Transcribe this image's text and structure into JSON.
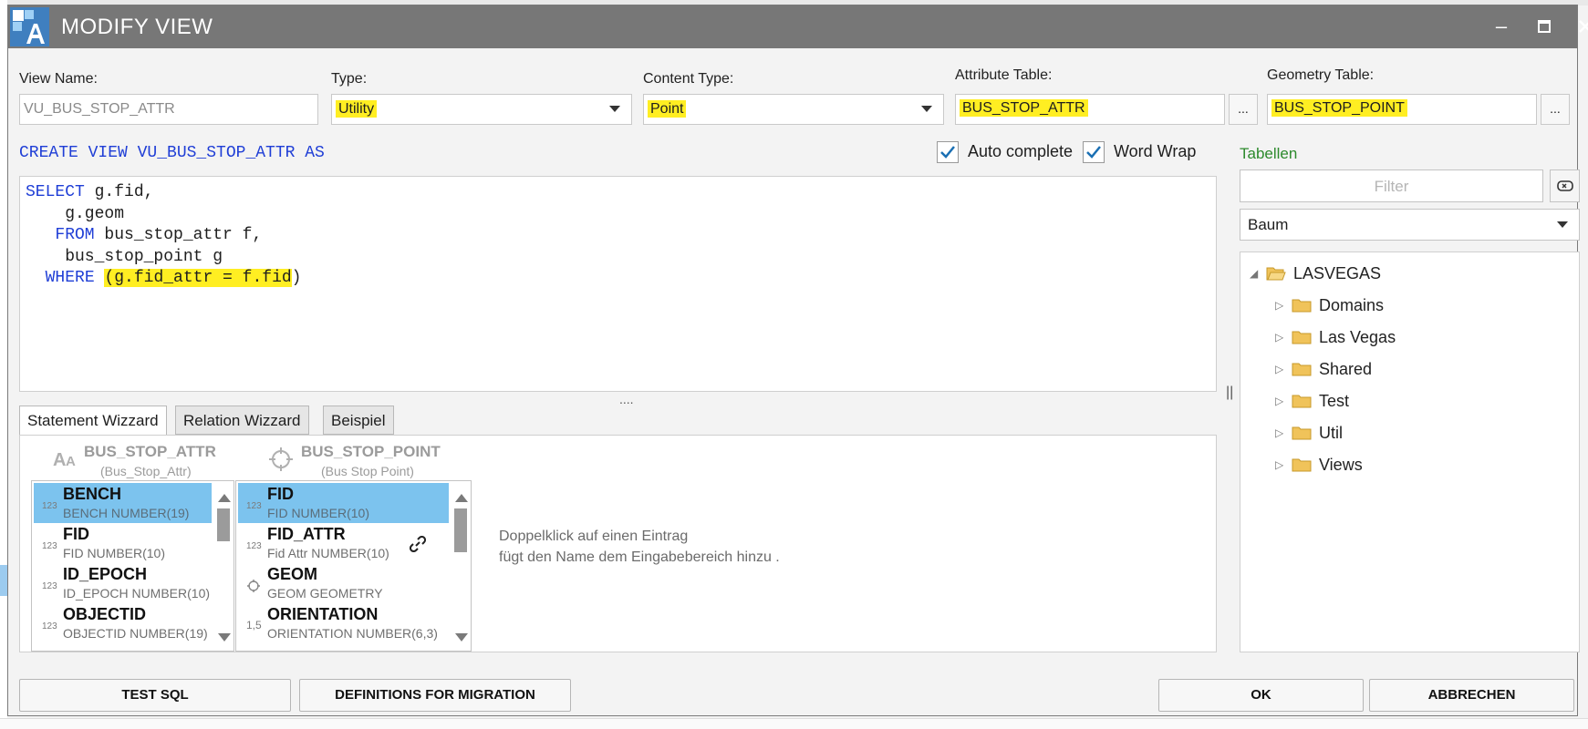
{
  "window": {
    "title": "MODIFY VIEW"
  },
  "fields": {
    "view_name_label": "View Name:",
    "view_name_value": "VU_BUS_STOP_ATTR",
    "type_label": "Type:",
    "type_value": "Utility",
    "content_type_label": "Content Type:",
    "content_type_value": "Point",
    "attribute_table_label": "Attribute Table:",
    "attribute_table_value": "BUS_STOP_ATTR",
    "geometry_table_label": "Geometry Table:",
    "geometry_table_value": "BUS_STOP_POINT",
    "browse_label": "..."
  },
  "editor": {
    "create_line": "CREATE VIEW VU_BUS_STOP_ATTR AS",
    "auto_complete_label": "Auto complete",
    "word_wrap_label": "Word Wrap",
    "auto_complete_checked": true,
    "word_wrap_checked": true,
    "lines": {
      "l1_kw": "SELECT",
      "l1_rest": " g.fid,",
      "l2": "    g.geom",
      "l3_indent": "   ",
      "l3_kw": "FROM",
      "l3_rest": " bus_stop_attr f,",
      "l4": "    bus_stop_point g",
      "l5_indent": "  ",
      "l5_kw": "WHERE",
      "l5_space": " ",
      "l5_cond": "(g.fid_attr = f.fid",
      "l5_end": ")"
    }
  },
  "tabs": [
    "Statement Wizzard",
    "Relation Wizzard",
    "Beispiel"
  ],
  "wizard": {
    "left_table": {
      "name": "BUS_STOP_ATTR",
      "alias": "(Bus_Stop_Attr)",
      "icon": "text-icon",
      "columns": [
        {
          "type_icon": "123",
          "name": "BENCH",
          "desc": "BENCH NUMBER(19)",
          "selected": true
        },
        {
          "type_icon": "123",
          "name": "FID",
          "desc": "FID NUMBER(10)",
          "selected": false
        },
        {
          "type_icon": "123",
          "name": "ID_EPOCH",
          "desc": "ID_EPOCH NUMBER(10)",
          "selected": false
        },
        {
          "type_icon": "123",
          "name": "OBJECTID",
          "desc": "OBJECTID NUMBER(19)",
          "selected": false
        }
      ]
    },
    "right_table": {
      "name": "BUS_STOP_POINT",
      "alias": "(Bus Stop Point)",
      "icon": "crosshair-icon",
      "columns": [
        {
          "type_icon": "123",
          "name": "FID",
          "desc": "FID NUMBER(10)",
          "selected": true
        },
        {
          "type_icon": "123",
          "name": "FID_ATTR",
          "desc": "Fid Attr NUMBER(10)",
          "selected": false
        },
        {
          "type_icon": "geometry",
          "name": "GEOM",
          "desc": "GEOM GEOMETRY",
          "selected": false
        },
        {
          "type_icon": "1,5",
          "name": "ORIENTATION",
          "desc": "ORIENTATION NUMBER(6,3)",
          "selected": false
        }
      ]
    },
    "hint_line1": "Doppelklick auf einen Eintrag",
    "hint_line2": "fügt den Name dem Eingabebereich hinzu ."
  },
  "sidebar": {
    "title": "Tabellen",
    "filter_placeholder": "Filter",
    "mode": "Baum",
    "tree": {
      "root": "LASVEGAS",
      "children": [
        "Domains",
        "Las Vegas",
        "Shared",
        "Test",
        "Util",
        "Views"
      ]
    }
  },
  "buttons": {
    "test_sql": "TEST SQL",
    "definitions": "DEFINITIONS FOR MIGRATION",
    "ok": "OK",
    "cancel": "ABBRECHEN"
  },
  "colors": {
    "titlebar": "#777777",
    "highlight": "#ffee22",
    "keyword": "#1f3ed6",
    "selection": "#7cc3ee",
    "tree_title": "#2c8a2c"
  }
}
